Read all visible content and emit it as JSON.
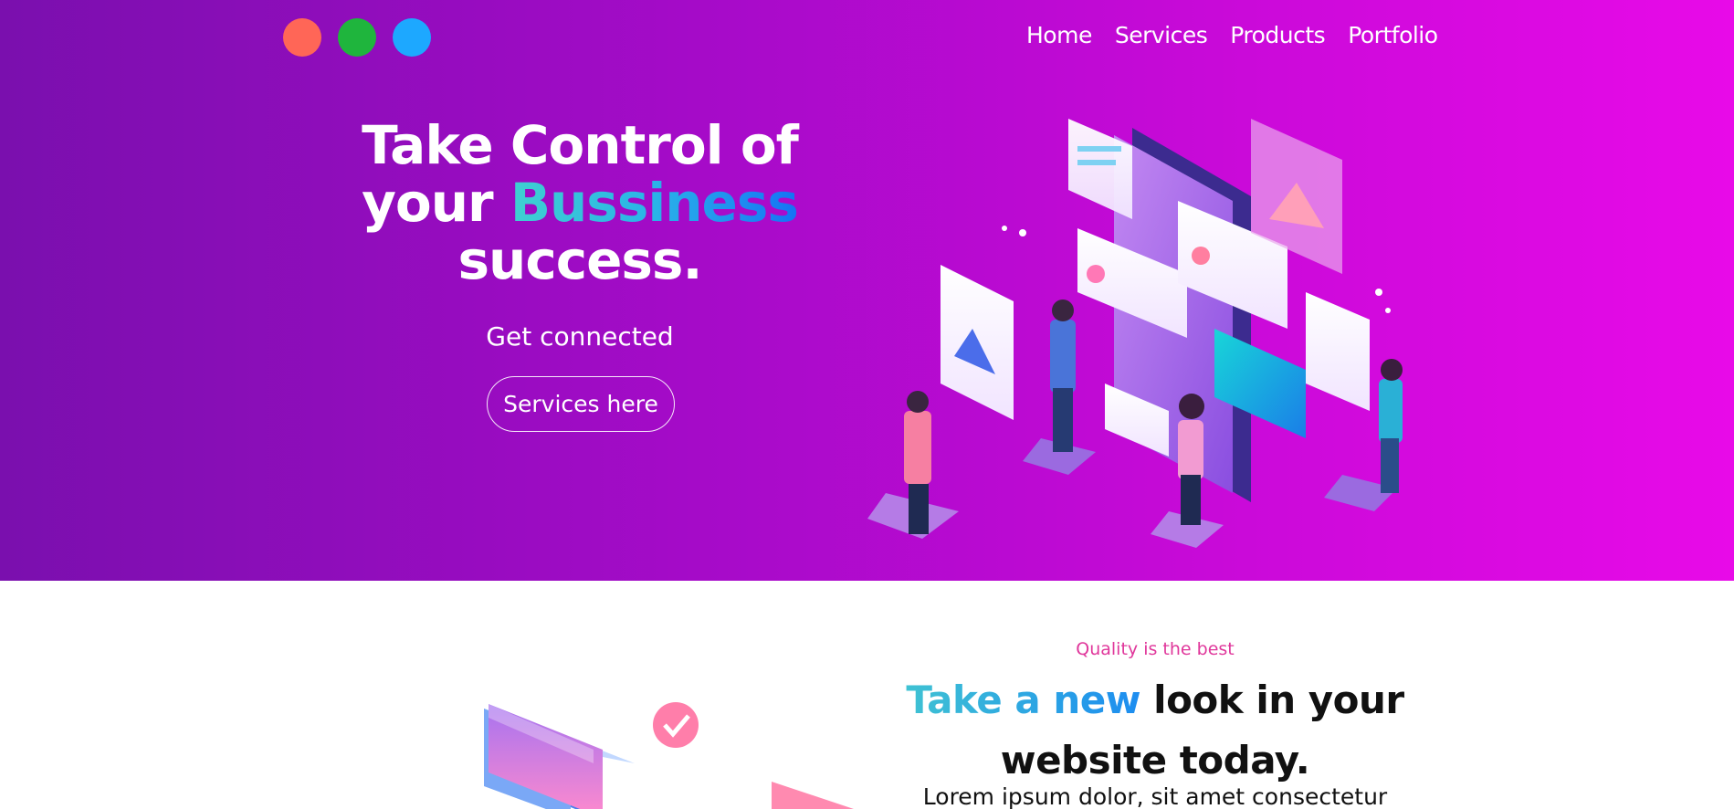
{
  "nav": {
    "dots": [
      {
        "name": "red",
        "color": "#ff6657"
      },
      {
        "name": "green",
        "color": "#1fb53d"
      },
      {
        "name": "blue",
        "color": "#1da8ff"
      }
    ],
    "items": [
      {
        "label": "Home"
      },
      {
        "label": "Services"
      },
      {
        "label": "Products"
      },
      {
        "label": "Portfolio"
      }
    ]
  },
  "hero": {
    "headline_line1": "Take Control of",
    "headline_your": "your ",
    "headline_highlight": "Bussiness",
    "headline_line3": "success.",
    "subtitle": "Get connected",
    "cta_label": "Services here",
    "background_gradient": [
      "#7a0fae",
      "#e80ae8"
    ],
    "illustration": "isometric-team-building-app-illustration"
  },
  "section2": {
    "eyebrow": "Quality is the best",
    "heading_highlight": "Take a new",
    "heading_rest1": " look in your",
    "heading_rest2": "website today.",
    "body": "Lorem ipsum dolor, sit amet consectetur",
    "illustration": "isometric-dashboard-phone-illustration"
  }
}
